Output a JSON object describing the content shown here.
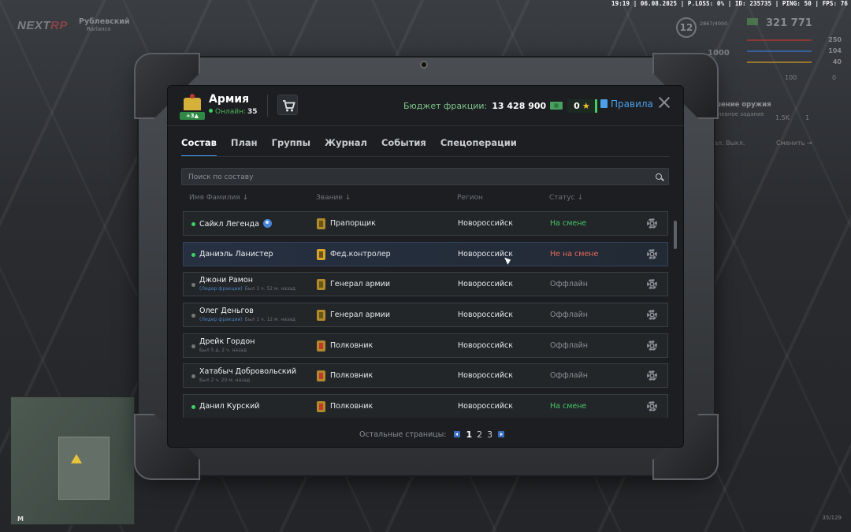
{
  "hud": {
    "topbar": "19:19 | 06.08.2025 | P.LOSS: 0% | ID: 235735 | PING: 50 | FPS: 76",
    "logo_main": "NEXT",
    "logo_accent": "RP",
    "server_name": "Рублевский",
    "server_sub": "Rarlanco",
    "level": "12",
    "level_sub": "2867/4000",
    "money": "321 771",
    "bars": [
      {
        "value": "250",
        "color": "#c0392b"
      },
      {
        "value": "104",
        "color": "#3a7bd5"
      },
      {
        "value": "40",
        "color": "#d4a021"
      }
    ],
    "stat_100": "100",
    "stat_0": "0",
    "hud_1000": "1000",
    "weapon_title": "шение оружия",
    "weapon_sub": "дневное задание",
    "weapon_val1": "1.5K",
    "weapon_val2": "1",
    "change_label": "ал. Выкл.",
    "change_btn": "Сменить →",
    "ammo": "35/129",
    "minimap_letter": "M"
  },
  "header": {
    "faction_name": "Армия",
    "faction_badge": "+3▲",
    "online_label": "Онлайн:",
    "online_count": "35",
    "budget_label": "Бюджет фракции:",
    "budget_value": "13 428 900",
    "stars_value": "0",
    "star_glyph": "★",
    "rules_label": "Правила"
  },
  "tabs": [
    {
      "label": "Состав"
    },
    {
      "label": "План"
    },
    {
      "label": "Группы"
    },
    {
      "label": "Журнал"
    },
    {
      "label": "События"
    },
    {
      "label": "Спецоперации"
    }
  ],
  "search": {
    "placeholder": "Поиск по составу"
  },
  "columns": {
    "name": "Имя Фамилия",
    "rank": "Звание",
    "region": "Регион",
    "status": "Статус",
    "sort_arrow": "↓"
  },
  "members": [
    {
      "name": "Сайкл Легенда",
      "sub": "",
      "leader": "",
      "rank": "Прапорщик",
      "region": "Новороссийск",
      "status": "На смене"
    },
    {
      "name": "Даниэль Ланистер",
      "sub": "",
      "leader": "",
      "rank": "Фед.контролер",
      "region": "Новороссийск",
      "status": "Не на смене"
    },
    {
      "name": "Джони Рамон",
      "sub": "Был 1 ч. 52 м. назад",
      "leader": "(Лидер фракции)",
      "rank": "Генерал армии",
      "region": "Новороссийск",
      "status": "Оффлайн"
    },
    {
      "name": "Олег Деньгов",
      "sub": "Был 1 ч. 12 м. назад",
      "leader": "(Лидер фракции)",
      "rank": "Генерал армии",
      "region": "Новороссийск",
      "status": "Оффлайн"
    },
    {
      "name": "Дрейк Гордон",
      "sub": "Был 5 д. 2 ч. назад",
      "leader": "",
      "rank": "Полковник",
      "region": "Новороссийск",
      "status": "Оффлайн"
    },
    {
      "name": "Хатабыч Добровольский",
      "sub": "Был 2 ч. 20 м. назад",
      "leader": "",
      "rank": "Полковник",
      "region": "Новороссийск",
      "status": "Оффлайн"
    },
    {
      "name": "Данил Курский",
      "sub": "",
      "leader": "",
      "rank": "Полковник",
      "region": "Новороссийск",
      "status": "На смене"
    }
  ],
  "pagination": {
    "label": "Остальные страницы:",
    "pages": [
      "1",
      "2",
      "3"
    ]
  }
}
